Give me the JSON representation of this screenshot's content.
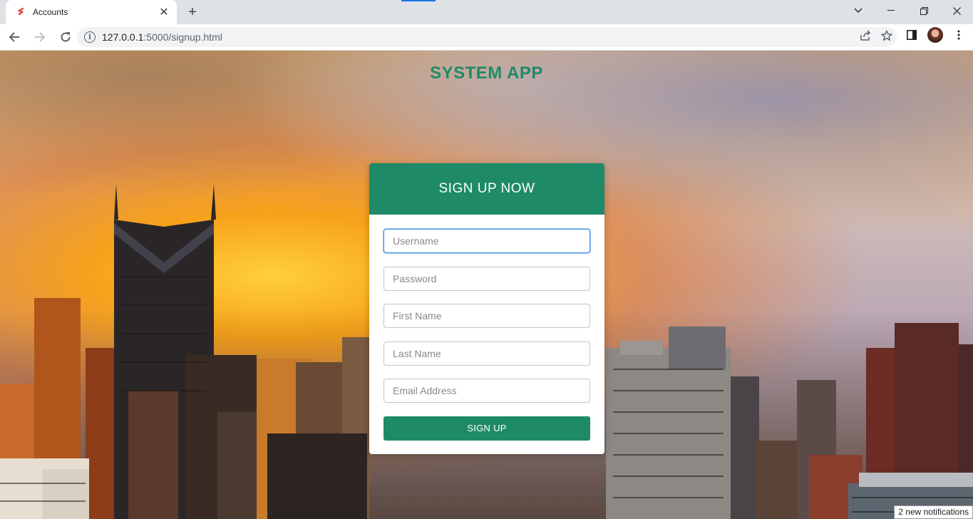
{
  "browser": {
    "tab_title": "Accounts",
    "new_tab": "+",
    "url_host": "127.0.0.1",
    "url_path": ":5000/signup.html"
  },
  "page": {
    "app_title": "SYSTEM APP",
    "form": {
      "header": "SIGN UP NOW",
      "fields": [
        {
          "placeholder": "Username",
          "value": ""
        },
        {
          "placeholder": "Password",
          "value": ""
        },
        {
          "placeholder": "First Name",
          "value": ""
        },
        {
          "placeholder": "Last Name",
          "value": ""
        },
        {
          "placeholder": "Email Address",
          "value": ""
        }
      ],
      "submit_label": "SIGN UP"
    },
    "notification": "2 new notifications"
  },
  "colors": {
    "accent": "#1f8a68",
    "focus": "#4a90e2"
  }
}
